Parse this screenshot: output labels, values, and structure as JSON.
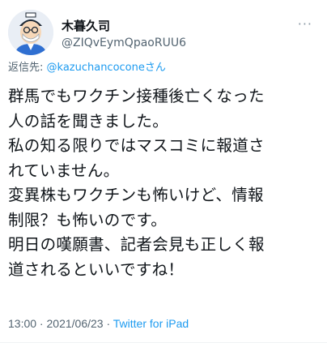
{
  "author": {
    "display_name": "木暮久司",
    "handle": "@ZIQvEymQpaoRUU6"
  },
  "reply": {
    "prefix": "返信先: ",
    "mention": "@kazuchancoconeさん"
  },
  "tweet": {
    "text": "群馬でもワクチン接種後亡くなった\n人の話を聞きました。\n私の知る限りではマスコミに報道さ\nれていません。\n変異株もワクチンも怖いけど、情報\n制限？も怖いのです。\n明日の嘆願書、記者会見も正しく報\n道されるといいですね！"
  },
  "meta": {
    "time": "13:00",
    "separator1": " · ",
    "date": "2021/06/23",
    "separator2": " · ",
    "source": "Twitter for iPad"
  },
  "icons": {
    "avatar": "avatar-illustration",
    "more": "more-options-icon"
  },
  "colors": {
    "link": "#1d9bf0",
    "secondary": "#536471",
    "text": "#0f1419"
  }
}
